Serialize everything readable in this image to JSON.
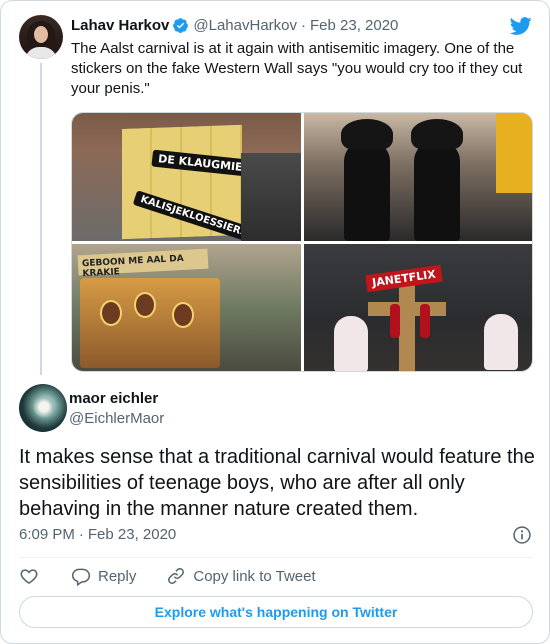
{
  "parent_tweet": {
    "author_name": "Lahav Harkov",
    "author_handle": "@LahavHarkov",
    "separator": "·",
    "date": "Feb 23, 2020",
    "text": "The Aalst carnival is at it again with antisemitic imagery. One of the stickers on the fake Western Wall says \"you would cry too if they cut your penis.\"",
    "verified": true,
    "media": {
      "photo1_sign_top": "DE KLAUGMIER",
      "photo1_sign_bottom": "KALISJEKLOESSIERS",
      "photo3_banner": "GEBOON ME AAL DA KRAKIE",
      "photo4_sign": "JANETFLIX"
    }
  },
  "reply_tweet": {
    "author_name": "maor eichler",
    "author_handle": "@EichlerMaor",
    "text": "It makes sense that a traditional carnival would feature the sensibilities of teenage boys, who are after all only behaving in the manner nature created them.",
    "time": "6:09 PM",
    "separator": "·",
    "date": "Feb 23, 2020"
  },
  "actions": {
    "reply_label": "Reply",
    "copy_link_label": "Copy link to Tweet"
  },
  "explore_label": "Explore what's happening on Twitter",
  "icons": {
    "brand": "twitter-bird-icon",
    "verified": "verified-badge-icon",
    "info": "info-icon",
    "like": "heart-icon",
    "reply": "reply-bubble-icon",
    "copy_link": "link-icon"
  },
  "colors": {
    "twitter_blue": "#1d9bf0",
    "text_primary": "#0f1419",
    "text_secondary": "#536471",
    "border": "#cfd9de"
  }
}
